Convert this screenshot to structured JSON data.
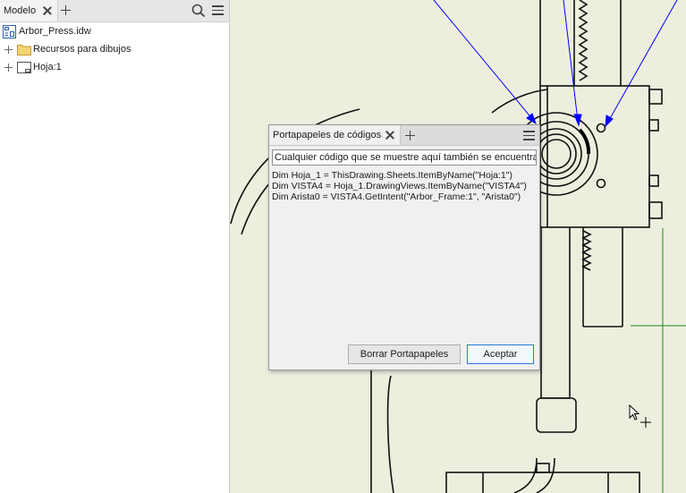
{
  "browser": {
    "tab_label": "Modelo",
    "items": [
      {
        "label": "Arbor_Press.idw",
        "icon": "drawing-file-icon"
      },
      {
        "label": "Recursos para dibujos",
        "icon": "folder-icon"
      },
      {
        "label": "Hoja:1",
        "icon": "sheet-icon"
      }
    ]
  },
  "dialog": {
    "tab_label": "Portapapeles de códigos",
    "info_text": "Cualquier código que se muestre aquí también se encuentra en el portapapeles",
    "code_lines": [
      "Dim Hoja_1 = ThisDrawing.Sheets.ItemByName(\"Hoja:1\")",
      "Dim VISTA4 = Hoja_1.DrawingViews.ItemByName(\"VISTA4\")",
      "Dim Arista0 = VISTA4.GetIntent(\"Arbor_Frame:1\", \"Arista0\")"
    ],
    "clear_button": "Borrar Portapapeles",
    "ok_button": "Aceptar"
  },
  "colors": {
    "canvas_bg": "#eeeedf",
    "leader_lines": "#0000ff",
    "green_line": "#008000",
    "primary_border": "#2a7bd6"
  }
}
